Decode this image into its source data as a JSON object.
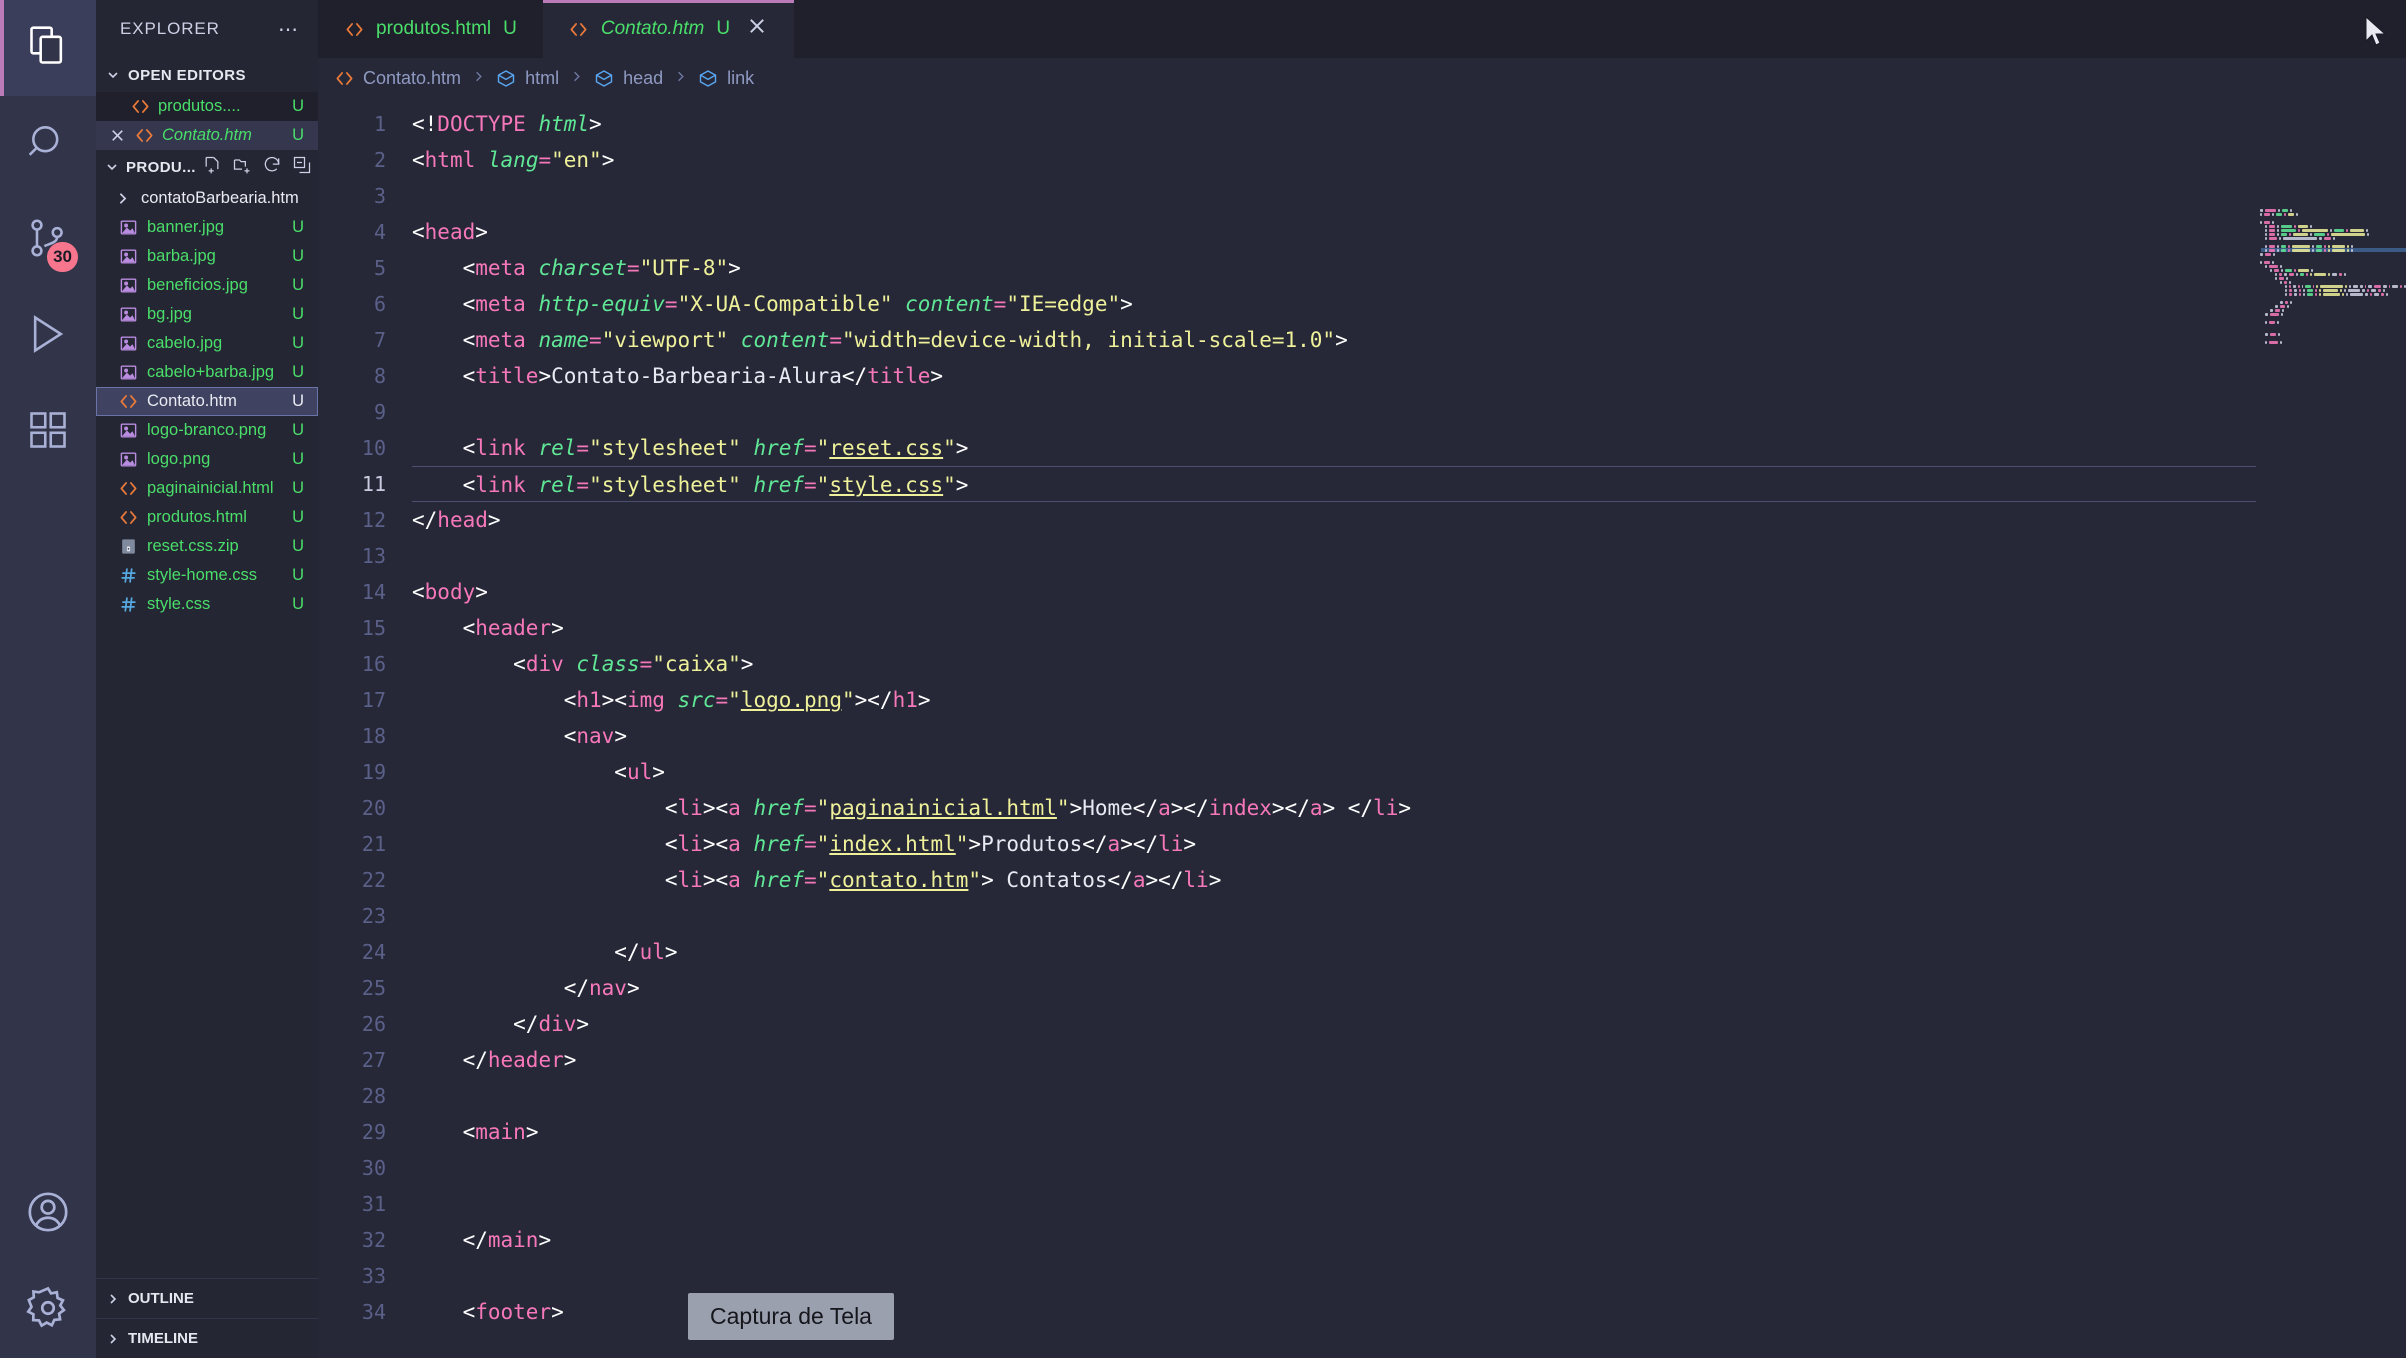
{
  "activitybar": {
    "items": [
      {
        "name": "explorer-icon",
        "label": "Explorer",
        "active": true
      },
      {
        "name": "search-icon",
        "label": "Search",
        "active": false
      },
      {
        "name": "source-control-icon",
        "label": "Source Control",
        "active": false,
        "badge": "30"
      },
      {
        "name": "run-debug-icon",
        "label": "Run and Debug",
        "active": false
      },
      {
        "name": "extensions-icon",
        "label": "Extensions",
        "active": false
      }
    ],
    "bottom": [
      {
        "name": "accounts-icon",
        "label": "Accounts"
      },
      {
        "name": "settings-gear-icon",
        "label": "Manage"
      }
    ],
    "badge_color": "#f7768e"
  },
  "sidebar": {
    "title": "EXPLORER",
    "more_actions": "⋯",
    "open_editors": {
      "label": "OPEN EDITORS",
      "items": [
        {
          "name": "produtos....",
          "icon": "html-icon",
          "badge": "U",
          "italic": false,
          "active": false,
          "has_close": false
        },
        {
          "name": "Contato.htm",
          "icon": "html-icon",
          "badge": "U",
          "italic": true,
          "active": true,
          "has_close": true
        }
      ]
    },
    "project": {
      "label": "PRODU...",
      "actions": [
        "new-file-icon",
        "new-folder-icon",
        "refresh-icon",
        "collapse-all-icon"
      ],
      "files": [
        {
          "name": "contatoBarbearia.htm",
          "icon": "folder-icon",
          "badge": "",
          "type": "folder",
          "selected": false
        },
        {
          "name": "banner.jpg",
          "icon": "image-icon",
          "badge": "U",
          "type": "image",
          "selected": false
        },
        {
          "name": "barba.jpg",
          "icon": "image-icon",
          "badge": "U",
          "type": "image",
          "selected": false
        },
        {
          "name": "beneficios.jpg",
          "icon": "image-icon",
          "badge": "U",
          "type": "image",
          "selected": false
        },
        {
          "name": "bg.jpg",
          "icon": "image-icon",
          "badge": "U",
          "type": "image",
          "selected": false
        },
        {
          "name": "cabelo.jpg",
          "icon": "image-icon",
          "badge": "U",
          "type": "image",
          "selected": false
        },
        {
          "name": "cabelo+barba.jpg",
          "icon": "image-icon",
          "badge": "U",
          "type": "image",
          "selected": false
        },
        {
          "name": "Contato.htm",
          "icon": "html-icon",
          "badge": "U",
          "type": "html",
          "selected": true
        },
        {
          "name": "logo-branco.png",
          "icon": "image-icon",
          "badge": "U",
          "type": "image",
          "selected": false
        },
        {
          "name": "logo.png",
          "icon": "image-icon",
          "badge": "U",
          "type": "image",
          "selected": false
        },
        {
          "name": "paginainicial.html",
          "icon": "html-icon",
          "badge": "U",
          "type": "html",
          "selected": false
        },
        {
          "name": "produtos.html",
          "icon": "html-icon",
          "badge": "U",
          "type": "html",
          "selected": false
        },
        {
          "name": "reset.css.zip",
          "icon": "zip-icon",
          "badge": "U",
          "type": "zip",
          "selected": false
        },
        {
          "name": "style-home.css",
          "icon": "css-icon",
          "badge": "U",
          "type": "css",
          "selected": false
        },
        {
          "name": "style.css",
          "icon": "css-icon",
          "badge": "U",
          "type": "css",
          "selected": false
        }
      ]
    },
    "outline_label": "OUTLINE",
    "timeline_label": "TIMELINE"
  },
  "tabs": [
    {
      "label": "produtos.html",
      "icon": "html-icon",
      "badge": "U",
      "active": false,
      "closable": false
    },
    {
      "label": "Contato.htm",
      "icon": "html-icon",
      "badge": "U",
      "active": true,
      "closable": true
    }
  ],
  "breadcrumb": [
    {
      "label": "Contato.htm",
      "icon": "html-icon"
    },
    {
      "label": "html",
      "icon": "symbol-cube-icon"
    },
    {
      "label": "head",
      "icon": "symbol-cube-icon"
    },
    {
      "label": "link",
      "icon": "symbol-cube-icon"
    }
  ],
  "editor": {
    "current_line": 11,
    "first_line": 1,
    "last_line": 33,
    "lines": [
      {
        "n": 1,
        "indent": 0,
        "tokens": [
          [
            "br",
            "<!"
          ],
          [
            "tg",
            "DOCTYPE"
          ],
          [
            "tx",
            " "
          ],
          [
            "at",
            "html"
          ],
          [
            "br",
            ">"
          ]
        ]
      },
      {
        "n": 2,
        "indent": 0,
        "tokens": [
          [
            "br",
            "<"
          ],
          [
            "tg",
            "html"
          ],
          [
            "tx",
            " "
          ],
          [
            "at",
            "lang"
          ],
          [
            "tg",
            "="
          ],
          [
            "st",
            "\"en\""
          ],
          [
            "br",
            ">"
          ]
        ]
      },
      {
        "n": 3,
        "indent": 0,
        "tokens": []
      },
      {
        "n": 4,
        "indent": 0,
        "tokens": [
          [
            "br",
            "<"
          ],
          [
            "tg",
            "head"
          ],
          [
            "br",
            ">"
          ]
        ]
      },
      {
        "n": 5,
        "indent": 1,
        "tokens": [
          [
            "br",
            "<"
          ],
          [
            "tg",
            "meta"
          ],
          [
            "tx",
            " "
          ],
          [
            "at",
            "charset"
          ],
          [
            "tg",
            "="
          ],
          [
            "st",
            "\"UTF-8\""
          ],
          [
            "br",
            ">"
          ]
        ]
      },
      {
        "n": 6,
        "indent": 1,
        "tokens": [
          [
            "br",
            "<"
          ],
          [
            "tg",
            "meta"
          ],
          [
            "tx",
            " "
          ],
          [
            "at",
            "http-equiv"
          ],
          [
            "tg",
            "="
          ],
          [
            "st",
            "\"X-UA-Compatible\""
          ],
          [
            "tx",
            " "
          ],
          [
            "at",
            "content"
          ],
          [
            "tg",
            "="
          ],
          [
            "st",
            "\"IE=edge\""
          ],
          [
            "br",
            ">"
          ]
        ]
      },
      {
        "n": 7,
        "indent": 1,
        "tokens": [
          [
            "br",
            "<"
          ],
          [
            "tg",
            "meta"
          ],
          [
            "tx",
            " "
          ],
          [
            "at",
            "name"
          ],
          [
            "tg",
            "="
          ],
          [
            "st",
            "\"viewport\""
          ],
          [
            "tx",
            " "
          ],
          [
            "at",
            "content"
          ],
          [
            "tg",
            "="
          ],
          [
            "st",
            "\"width=device-width, initial-scale=1.0\""
          ],
          [
            "br",
            ">"
          ]
        ]
      },
      {
        "n": 8,
        "indent": 1,
        "tokens": [
          [
            "br",
            "<"
          ],
          [
            "tg",
            "title"
          ],
          [
            "br",
            ">"
          ],
          [
            "tx",
            "Contato-Barbearia-Alura"
          ],
          [
            "br",
            "</"
          ],
          [
            "tg",
            "title"
          ],
          [
            "br",
            ">"
          ]
        ]
      },
      {
        "n": 9,
        "indent": 1,
        "tokens": []
      },
      {
        "n": 10,
        "indent": 1,
        "tokens": [
          [
            "br",
            "<"
          ],
          [
            "tg",
            "link"
          ],
          [
            "tx",
            " "
          ],
          [
            "at",
            "rel"
          ],
          [
            "tg",
            "="
          ],
          [
            "st",
            "\"stylesheet\""
          ],
          [
            "tx",
            " "
          ],
          [
            "at",
            "href"
          ],
          [
            "tg",
            "="
          ],
          [
            "st",
            "\""
          ],
          [
            "stu",
            "reset.css"
          ],
          [
            "st",
            "\""
          ],
          [
            "br",
            ">"
          ]
        ]
      },
      {
        "n": 11,
        "indent": 1,
        "tokens": [
          [
            "br",
            "<"
          ],
          [
            "tg",
            "link"
          ],
          [
            "tx",
            " "
          ],
          [
            "at",
            "rel"
          ],
          [
            "tg",
            "="
          ],
          [
            "st",
            "\"stylesheet\""
          ],
          [
            "tx",
            " "
          ],
          [
            "at",
            "href"
          ],
          [
            "tg",
            "="
          ],
          [
            "st",
            "\""
          ],
          [
            "stu",
            "style.css"
          ],
          [
            "st",
            "\""
          ],
          [
            "br",
            ">"
          ]
        ]
      },
      {
        "n": 12,
        "indent": 0,
        "tokens": [
          [
            "br",
            "</"
          ],
          [
            "tg",
            "head"
          ],
          [
            "br",
            ">"
          ]
        ]
      },
      {
        "n": 13,
        "indent": 0,
        "tokens": []
      },
      {
        "n": 14,
        "indent": 0,
        "tokens": [
          [
            "br",
            "<"
          ],
          [
            "tg",
            "body"
          ],
          [
            "br",
            ">"
          ]
        ]
      },
      {
        "n": 15,
        "indent": 1,
        "tokens": [
          [
            "br",
            "<"
          ],
          [
            "tg",
            "header"
          ],
          [
            "br",
            ">"
          ]
        ]
      },
      {
        "n": 16,
        "indent": 2,
        "tokens": [
          [
            "br",
            "<"
          ],
          [
            "tg",
            "div"
          ],
          [
            "tx",
            " "
          ],
          [
            "at",
            "class"
          ],
          [
            "tg",
            "="
          ],
          [
            "st",
            "\"caixa\""
          ],
          [
            "br",
            ">"
          ]
        ]
      },
      {
        "n": 17,
        "indent": 3,
        "tokens": [
          [
            "br",
            "<"
          ],
          [
            "tg",
            "h1"
          ],
          [
            "br",
            "><"
          ],
          [
            "tg",
            "img"
          ],
          [
            "tx",
            " "
          ],
          [
            "at",
            "src"
          ],
          [
            "tg",
            "="
          ],
          [
            "st",
            "\""
          ],
          [
            "stu",
            "logo.png"
          ],
          [
            "st",
            "\""
          ],
          [
            "br",
            "></"
          ],
          [
            "tg",
            "h1"
          ],
          [
            "br",
            ">"
          ]
        ]
      },
      {
        "n": 18,
        "indent": 3,
        "tokens": [
          [
            "br",
            "<"
          ],
          [
            "tg",
            "nav"
          ],
          [
            "br",
            ">"
          ]
        ]
      },
      {
        "n": 19,
        "indent": 4,
        "tokens": [
          [
            "br",
            "<"
          ],
          [
            "tg",
            "ul"
          ],
          [
            "br",
            ">"
          ]
        ]
      },
      {
        "n": 20,
        "indent": 5,
        "tokens": [
          [
            "br",
            "<"
          ],
          [
            "tg",
            "li"
          ],
          [
            "br",
            "><"
          ],
          [
            "tg",
            "a"
          ],
          [
            "tx",
            " "
          ],
          [
            "at",
            "href"
          ],
          [
            "tg",
            "="
          ],
          [
            "st",
            "\""
          ],
          [
            "stu",
            "paginainicial.html"
          ],
          [
            "st",
            "\""
          ],
          [
            "br",
            ">"
          ],
          [
            "tx",
            "Home"
          ],
          [
            "br",
            "</"
          ],
          [
            "tg",
            "a"
          ],
          [
            "br",
            "></"
          ],
          [
            "tg",
            "index"
          ],
          [
            "br",
            "></"
          ],
          [
            "tg",
            "a"
          ],
          [
            "br",
            "> </"
          ],
          [
            "tg",
            "li"
          ],
          [
            "br",
            ">"
          ]
        ]
      },
      {
        "n": 21,
        "indent": 5,
        "tokens": [
          [
            "br",
            "<"
          ],
          [
            "tg",
            "li"
          ],
          [
            "br",
            "><"
          ],
          [
            "tg",
            "a"
          ],
          [
            "tx",
            " "
          ],
          [
            "at",
            "href"
          ],
          [
            "tg",
            "="
          ],
          [
            "st",
            "\""
          ],
          [
            "stu",
            "index.html"
          ],
          [
            "st",
            "\""
          ],
          [
            "br",
            ">"
          ],
          [
            "tx",
            "Produtos"
          ],
          [
            "br",
            "</"
          ],
          [
            "tg",
            "a"
          ],
          [
            "br",
            "></"
          ],
          [
            "tg",
            "li"
          ],
          [
            "br",
            ">"
          ]
        ]
      },
      {
        "n": 22,
        "indent": 5,
        "tokens": [
          [
            "br",
            "<"
          ],
          [
            "tg",
            "li"
          ],
          [
            "br",
            "><"
          ],
          [
            "tg",
            "a"
          ],
          [
            "tx",
            " "
          ],
          [
            "at",
            "href"
          ],
          [
            "tg",
            "="
          ],
          [
            "st",
            "\""
          ],
          [
            "stu",
            "contato.htm"
          ],
          [
            "st",
            "\""
          ],
          [
            "br",
            ">"
          ],
          [
            "tx",
            " Contatos"
          ],
          [
            "br",
            "</"
          ],
          [
            "tg",
            "a"
          ],
          [
            "br",
            "></"
          ],
          [
            "tg",
            "li"
          ],
          [
            "br",
            ">"
          ]
        ]
      },
      {
        "n": 23,
        "indent": 0,
        "tokens": []
      },
      {
        "n": 24,
        "indent": 4,
        "tokens": [
          [
            "br",
            "</"
          ],
          [
            "tg",
            "ul"
          ],
          [
            "br",
            ">"
          ]
        ]
      },
      {
        "n": 25,
        "indent": 3,
        "tokens": [
          [
            "br",
            "</"
          ],
          [
            "tg",
            "nav"
          ],
          [
            "br",
            ">"
          ]
        ]
      },
      {
        "n": 26,
        "indent": 2,
        "tokens": [
          [
            "br",
            "</"
          ],
          [
            "tg",
            "div"
          ],
          [
            "br",
            ">"
          ]
        ]
      },
      {
        "n": 27,
        "indent": 1,
        "tokens": [
          [
            "br",
            "</"
          ],
          [
            "tg",
            "header"
          ],
          [
            "br",
            ">"
          ]
        ]
      },
      {
        "n": 28,
        "indent": 0,
        "tokens": []
      },
      {
        "n": 29,
        "indent": 1,
        "tokens": [
          [
            "br",
            "<"
          ],
          [
            "tg",
            "main"
          ],
          [
            "br",
            ">"
          ]
        ]
      },
      {
        "n": 30,
        "indent": 0,
        "tokens": []
      },
      {
        "n": 31,
        "indent": 0,
        "tokens": []
      },
      {
        "n": 32,
        "indent": 1,
        "tokens": [
          [
            "br",
            "</"
          ],
          [
            "tg",
            "main"
          ],
          [
            "br",
            ">"
          ]
        ]
      },
      {
        "n": 33,
        "indent": 0,
        "tokens": []
      },
      {
        "n": 34,
        "indent": 1,
        "tokens": [
          [
            "br",
            "<"
          ],
          [
            "tg",
            "footer"
          ],
          [
            "br",
            ">"
          ]
        ]
      }
    ]
  },
  "tooltip": {
    "text": "Captura de Tela"
  },
  "colors": {
    "accent": "#bb7ab8",
    "background": "#262837",
    "sidebar": "#252633",
    "activitybar": "#32344a",
    "tag": "#f778ba",
    "attribute": "#60e796",
    "string": "#eff09a",
    "untracked": "#4ade6a",
    "badge": "#f7768e"
  }
}
